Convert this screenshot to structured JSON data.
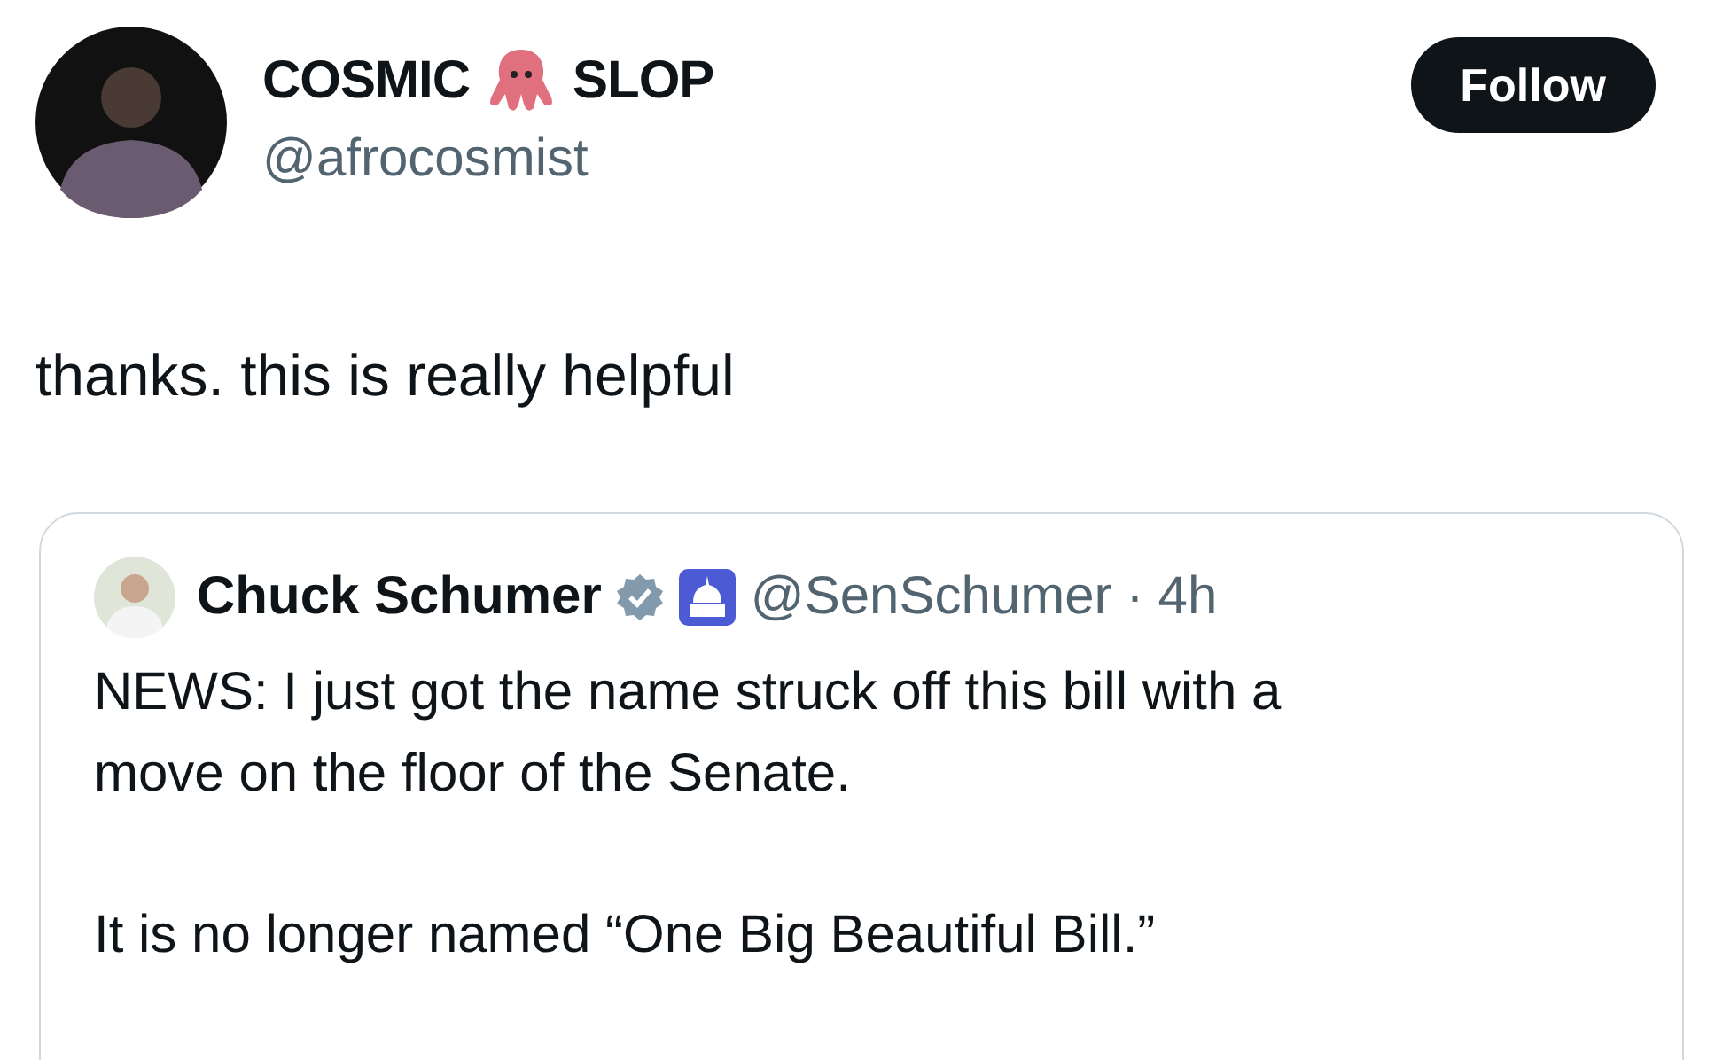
{
  "author": {
    "name_before": "COSMIC",
    "name_after": "SLOP",
    "handle": "@afrocosmist"
  },
  "follow_button": {
    "label": "Follow"
  },
  "tweet_text": "thanks. this is really helpful",
  "quoted_tweet": {
    "name": "Chuck Schumer",
    "verified": true,
    "handle": "@SenSchumer",
    "separator": "·",
    "time": "4h",
    "paragraphs": [
      "NEWS: I just got the name struck off this bill with a move on the floor of the Senate.",
      "It is no longer named “One Big Beautiful Bill.”"
    ]
  }
}
